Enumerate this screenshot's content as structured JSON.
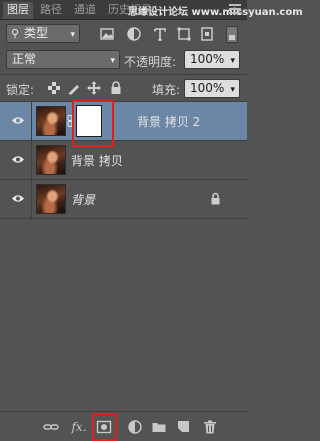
{
  "tabs": [
    {
      "label": "图层",
      "active": true
    },
    {
      "label": "路径",
      "active": false
    },
    {
      "label": "通道",
      "active": false
    },
    {
      "label": "历史记录",
      "active": false
    }
  ],
  "watermark": "思缘设计论坛 www.missyuan.com",
  "filter": {
    "kind_label": "类型"
  },
  "blend": {
    "mode": "正常",
    "opacity_label": "不透明度:",
    "opacity_value": "100%"
  },
  "lock": {
    "label": "锁定:",
    "fill_label": "填充:",
    "fill_value": "100%"
  },
  "layers": [
    {
      "name": "背景 拷贝 2",
      "selected": true,
      "has_mask": true
    },
    {
      "name": "背景 拷贝",
      "selected": false,
      "has_mask": false
    },
    {
      "name": "背景",
      "selected": false,
      "has_mask": false,
      "locked": true
    }
  ],
  "bottom": {
    "fx_label": "fx."
  },
  "colors": {
    "selection": "#6c86a6",
    "highlight_box": "#e02020",
    "panel_bg": "#535353"
  }
}
